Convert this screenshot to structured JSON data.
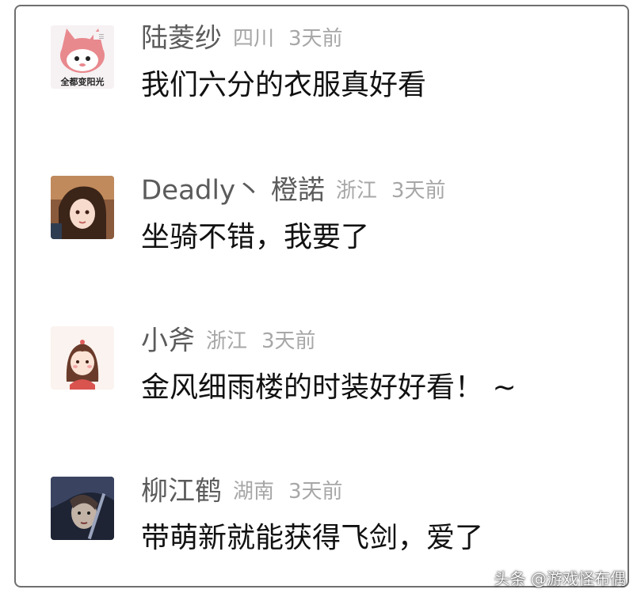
{
  "comments": [
    {
      "username": "陆菱纱",
      "location": "四川",
      "time": "3天前",
      "text": "我们六分的衣服真好看",
      "avatar": "kuromi-avatar-icon"
    },
    {
      "username": "Deadly丶 橙諾",
      "location": "浙江",
      "time": "3天前",
      "text": "坐骑不错，我要了",
      "avatar": "anime-girl-avatar-icon"
    },
    {
      "username": "小斧",
      "location": "浙江",
      "time": "3天前",
      "text": "金风细雨楼的时装好好看！ ~",
      "avatar": "cartoon-girl-avatar-icon"
    },
    {
      "username": "柳江鹤",
      "location": "湖南",
      "time": "3天前",
      "text": "带萌新就能获得飞剑，爱了",
      "avatar": "warrior-avatar-icon"
    }
  ],
  "avatar1_caption": "全都变阳光",
  "watermark": "头条 @游戏怪布偶"
}
